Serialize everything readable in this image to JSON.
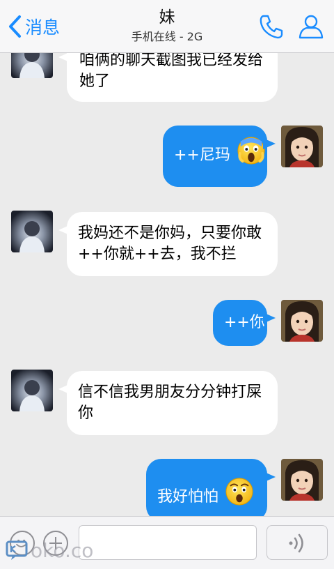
{
  "header": {
    "back_label": "消息",
    "title": "妹",
    "subtitle": "手机在线 - 2G",
    "accent_color": "#1a8cff"
  },
  "messages": [
    {
      "direction": "incoming",
      "text": "咱俩的聊天截图我已经发给她了"
    },
    {
      "direction": "outgoing",
      "text": "++尼玛",
      "emoji": "face-screaming-in-fear"
    },
    {
      "direction": "incoming",
      "text": "我妈还不是你妈，只要你敢++你就++去，我不拦"
    },
    {
      "direction": "outgoing",
      "text": "++你"
    },
    {
      "direction": "incoming",
      "text": "信不信我男朋友分分钟打屎你"
    },
    {
      "direction": "outgoing",
      "text": "我好怕怕",
      "emoji": "astonished-face"
    }
  ],
  "input_bar": {
    "input_value": "",
    "icons": [
      "smiley-icon",
      "plus-icon",
      "voice-wave-icon"
    ]
  },
  "colors": {
    "background": "#ebebeb",
    "outgoing_bubble": "#1e8ef0",
    "incoming_bubble": "#ffffff"
  }
}
